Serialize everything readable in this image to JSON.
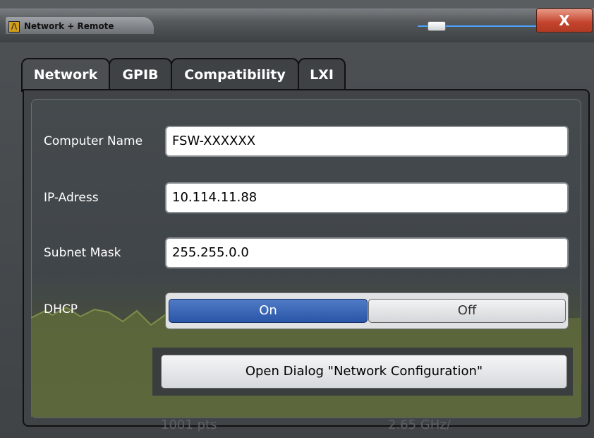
{
  "window": {
    "title": "Network + Remote",
    "close_label": "X"
  },
  "tabs": [
    {
      "label": "Network",
      "active": true
    },
    {
      "label": "GPIB",
      "active": false
    },
    {
      "label": "Compatibility",
      "active": false
    },
    {
      "label": "LXI",
      "active": false
    }
  ],
  "form": {
    "computer_name_label": "Computer Name",
    "computer_name_value": "FSW-XXXXXX",
    "ip_label": "IP-Adress",
    "ip_value": "10.114.11.88",
    "subnet_label": "Subnet Mask",
    "subnet_value": "255.255.0.0",
    "dhcp_label": "DHCP",
    "dhcp_on": "On",
    "dhcp_off": "Off",
    "dhcp_selected": "On"
  },
  "open_dialog_label": "Open Dialog \"Network Configuration\"",
  "background": {
    "pts_text": "1001 pts",
    "freq_text": "2.65 GHz/"
  },
  "colors": {
    "accent_blue": "#2a56a8",
    "close_red": "#c4432c",
    "trace_olive": "#6a7a40"
  }
}
